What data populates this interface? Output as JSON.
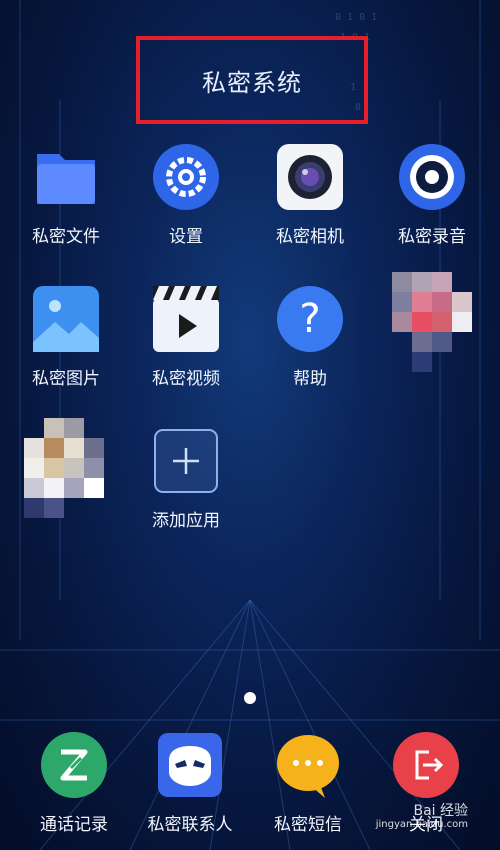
{
  "title": "私密系统",
  "apps_row1": [
    {
      "label": "私密文件",
      "icon": "folder-icon"
    },
    {
      "label": "设置",
      "icon": "gear-icon"
    },
    {
      "label": "私密相机",
      "icon": "camera-icon"
    },
    {
      "label": "私密录音",
      "icon": "recorder-icon"
    }
  ],
  "apps_row2": [
    {
      "label": "私密图片",
      "icon": "image-icon"
    },
    {
      "label": "私密视频",
      "icon": "video-clapper-icon"
    },
    {
      "label": "帮助",
      "icon": "question-icon"
    }
  ],
  "apps_row3": [
    {
      "label": "添加应用",
      "icon": "plus-icon"
    }
  ],
  "dock": [
    {
      "label": "通话记录",
      "icon": "call-log-icon"
    },
    {
      "label": "私密联系人",
      "icon": "mask-contact-icon"
    },
    {
      "label": "私密短信",
      "icon": "message-bubble-icon"
    },
    {
      "label": "关闭",
      "icon": "exit-icon"
    }
  ],
  "watermark": {
    "main": "Bai 经验",
    "sub": "jingyan.baidu.com"
  },
  "colors": {
    "highlight": "#e5202a",
    "background": "#0b2459"
  }
}
